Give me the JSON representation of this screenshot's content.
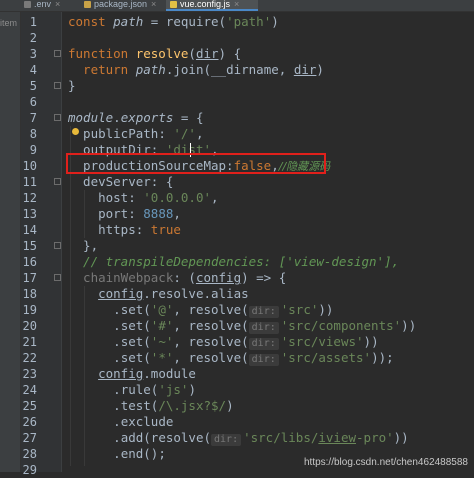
{
  "tabs": [
    {
      "label": ".env",
      "icon": "env-file-icon",
      "active": false
    },
    {
      "label": "package.json",
      "icon": "json-file-icon",
      "active": false
    },
    {
      "label": "vue.config.js",
      "icon": "js-file-icon",
      "active": true
    }
  ],
  "side_panel": {
    "label": "item"
  },
  "line_numbers": [
    "1",
    "2",
    "3",
    "4",
    "5",
    "6",
    "7",
    "8",
    "9",
    "10",
    "11",
    "12",
    "13",
    "14",
    "15",
    "16",
    "17",
    "18",
    "19",
    "20",
    "21",
    "22",
    "23",
    "24",
    "25",
    "26",
    "27",
    "28",
    "29"
  ],
  "code": {
    "l1": {
      "t1": "const ",
      "t2": "path",
      "t3": " = ",
      "t4": "require",
      "t5": "(",
      "t6": "'path'",
      "t7": ")"
    },
    "l3": {
      "t1": "function ",
      "t2": "resolve",
      "t3": "(",
      "t4": "dir",
      "t5": ") {"
    },
    "l4": {
      "t1": "  return ",
      "t2": "path",
      "t3": ".",
      "t4": "join",
      "t5": "(",
      "t6": "__dirname",
      "t7": ", ",
      "t8": "dir",
      "t9": ")"
    },
    "l5": {
      "t1": "}"
    },
    "l7": {
      "t1": "module",
      "t2": ".",
      "t3": "exports",
      "t4": " = {"
    },
    "l8": {
      "t1": "  publicPath",
      "t2": ": ",
      "t3": "'/'",
      "t4": ","
    },
    "l9": {
      "t1": "  outputDir",
      "t2": ": ",
      "t3": "'dist'",
      "t4": ","
    },
    "l10": {
      "t1": "  productionSourceMap",
      "t2": ":",
      "t3": "false",
      "t4": ",",
      "t5": "//隐藏源码"
    },
    "l11": {
      "t1": "  devServer",
      "t2": ": {"
    },
    "l12": {
      "t1": "    host",
      "t2": ": ",
      "t3": "'0.0.0.0'",
      "t4": ","
    },
    "l13": {
      "t1": "    port",
      "t2": ": ",
      "t3": "8888",
      "t4": ","
    },
    "l14": {
      "t1": "    https",
      "t2": ": ",
      "t3": "true"
    },
    "l15": {
      "t1": "  },"
    },
    "l16": {
      "t1": "  // transpileDependencies: ['view-design'],"
    },
    "l17": {
      "t1": "  chainWebpack",
      "t2": ": (",
      "t3": "config",
      "t4": ") => {"
    },
    "l18": {
      "t1": "    ",
      "t2": "config",
      "t3": ".",
      "t4": "resolve",
      "t5": ".",
      "t6": "alias"
    },
    "l19": {
      "t1": "      .",
      "t2": "set",
      "t3": "(",
      "t4": "'@'",
      "t5": ", ",
      "t6": "resolve",
      "t7": "(",
      "t8": "dir:",
      "t9": "'src'",
      "t10": "))"
    },
    "l20": {
      "t1": "      .",
      "t2": "set",
      "t3": "(",
      "t4": "'#'",
      "t5": ", ",
      "t6": "resolve",
      "t7": "(",
      "t8": "dir:",
      "t9": "'src/components'",
      "t10": "))"
    },
    "l21": {
      "t1": "      .",
      "t2": "set",
      "t3": "(",
      "t4": "'~'",
      "t5": ", ",
      "t6": "resolve",
      "t7": "(",
      "t8": "dir:",
      "t9": "'src/views'",
      "t10": "))"
    },
    "l22": {
      "t1": "      .",
      "t2": "set",
      "t3": "(",
      "t4": "'*'",
      "t5": ", ",
      "t6": "resolve",
      "t7": "(",
      "t8": "dir:",
      "t9": "'src/assets'",
      "t10": "));"
    },
    "l23": {
      "t1": "    ",
      "t2": "config",
      "t3": ".",
      "t4": "module"
    },
    "l24": {
      "t1": "      .",
      "t2": "rule",
      "t3": "(",
      "t4": "'js'",
      "t5": ")"
    },
    "l25": {
      "t1": "      .",
      "t2": "test",
      "t3": "(",
      "t4": "/\\.jsx?$/",
      "t5": ")"
    },
    "l26": {
      "t1": "      .",
      "t2": "exclude"
    },
    "l27": {
      "t1": "      .",
      "t2": "add",
      "t3": "(",
      "t4": "resolve",
      "t5": "(",
      "t6": "dir:",
      "t7": "'src/libs/",
      "t8": "iview",
      "t9": "-pro'",
      "t10": "))"
    },
    "l28": {
      "t1": "      .",
      "t2": "end",
      "t3": "();"
    }
  },
  "watermark": "https://blog.csdn.net/chen462488588",
  "colors": {
    "background": "#2b2b2b",
    "keyword": "#cc7832",
    "string": "#6a8759",
    "function": "#ffc66d",
    "number": "#6897bb",
    "property": "#9876aa",
    "comment": "#629755",
    "highlight_border": "#e0201b"
  }
}
